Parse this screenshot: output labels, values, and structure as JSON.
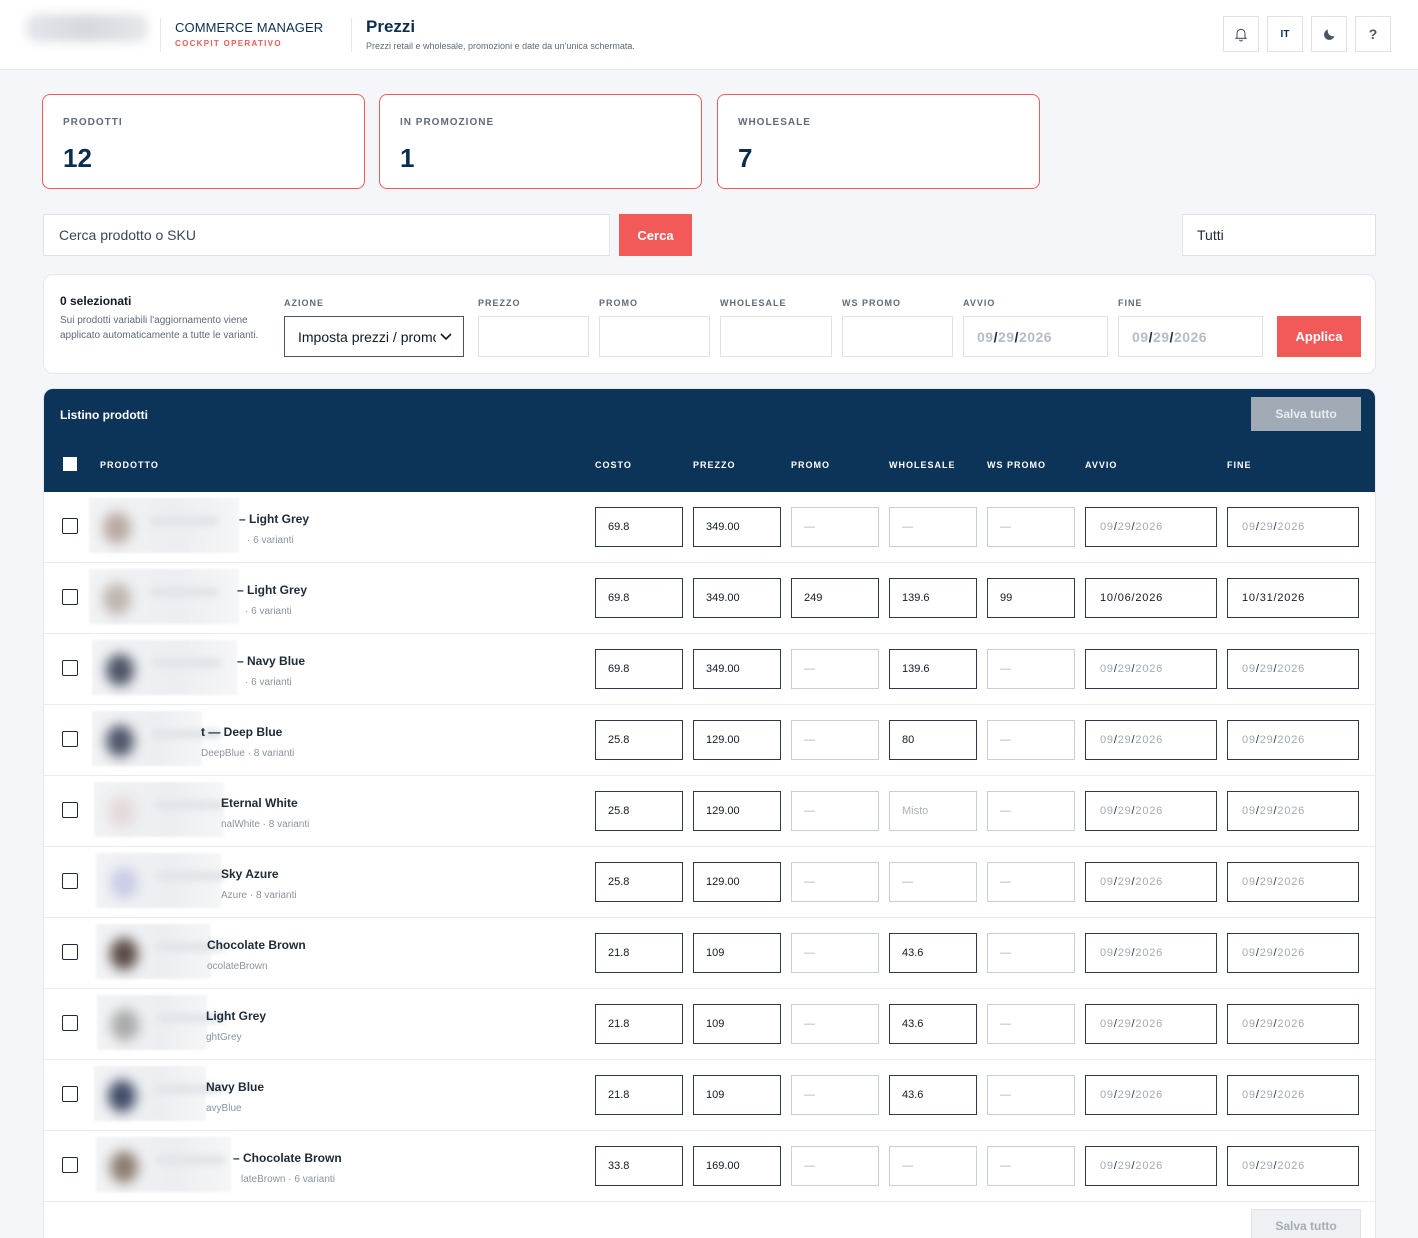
{
  "header": {
    "brand_title": "COMMERCE MANAGER",
    "brand_subtitle": "COCKPIT OPERATIVO",
    "page_title": "Prezzi",
    "page_subtitle": "Prezzi retail e wholesale, promozioni e date da un'unica schermata.",
    "lang": "IT",
    "help": "?"
  },
  "stats": [
    {
      "label": "PRODOTTI",
      "value": "12"
    },
    {
      "label": "IN PROMOZIONE",
      "value": "1"
    },
    {
      "label": "WHOLESALE",
      "value": "7"
    }
  ],
  "search": {
    "placeholder": "Cerca prodotto o SKU",
    "button": "Cerca",
    "filter": "Tutti"
  },
  "bulk": {
    "selected": "0 selezionati",
    "note": "Sui prodotti variabili l'aggiornamento viene applicato automaticamente a tutte le varianti.",
    "labels": {
      "azione": "AZIONE",
      "prezzo": "PREZZO",
      "promo": "PROMO",
      "wholesale": "WHOLESALE",
      "ws_promo": "WS PROMO",
      "avvio": "AVVIO",
      "fine": "FINE"
    },
    "action_value": "Imposta prezzi / promo",
    "date_placeholder": {
      "mm": "09",
      "dd": "29",
      "yyyy": "2026"
    },
    "apply": "Applica"
  },
  "table": {
    "title": "Listino prodotti",
    "save": "Salva tutto",
    "columns": {
      "prodotto": "PRODOTTO",
      "costo": "COSTO",
      "prezzo": "PREZZO",
      "promo": "PROMO",
      "wholesale": "WHOLESALE",
      "ws_promo": "WS PROMO",
      "avvio": "AVVIO",
      "fine": "FINE"
    },
    "empty": "—",
    "rows": [
      {
        "name": "– Light Grey",
        "meta": "· 6 varianti",
        "costo": "69.8",
        "prezzo": "349.00",
        "promo": "",
        "wholesale": "",
        "ws_promo": "",
        "avvio": "",
        "fine": ""
      },
      {
        "name": "– Light Grey",
        "meta": "· 6 varianti",
        "costo": "69.8",
        "prezzo": "349.00",
        "promo": "249",
        "wholesale": "139.6",
        "ws_promo": "99",
        "avvio": "10/06/2026",
        "fine": "10/31/2026"
      },
      {
        "name": "– Navy Blue",
        "meta": "· 6 varianti",
        "costo": "69.8",
        "prezzo": "349.00",
        "promo": "",
        "wholesale": "139.6",
        "ws_promo": "",
        "avvio": "",
        "fine": ""
      },
      {
        "name": "t — Deep Blue",
        "meta": "DeepBlue · 8 varianti",
        "costo": "25.8",
        "prezzo": "129.00",
        "promo": "",
        "wholesale": "80",
        "ws_promo": "",
        "avvio": "",
        "fine": ""
      },
      {
        "name": "Eternal White",
        "meta": "nalWhite · 8 varianti",
        "costo": "25.8",
        "prezzo": "129.00",
        "promo": "",
        "wholesale": "Misto",
        "ws_promo": "",
        "avvio": "",
        "fine": ""
      },
      {
        "name": "Sky Azure",
        "meta": "Azure · 8 varianti",
        "costo": "25.8",
        "prezzo": "129.00",
        "promo": "",
        "wholesale": "",
        "ws_promo": "",
        "avvio": "",
        "fine": ""
      },
      {
        "name": "Chocolate Brown",
        "meta": "ocolateBrown",
        "costo": "21.8",
        "prezzo": "109",
        "promo": "",
        "wholesale": "43.6",
        "ws_promo": "",
        "avvio": "",
        "fine": ""
      },
      {
        "name": "Light Grey",
        "meta": "ghtGrey",
        "costo": "21.8",
        "prezzo": "109",
        "promo": "",
        "wholesale": "43.6",
        "ws_promo": "",
        "avvio": "",
        "fine": ""
      },
      {
        "name": "Navy Blue",
        "meta": "avyBlue",
        "costo": "21.8",
        "prezzo": "109",
        "promo": "",
        "wholesale": "43.6",
        "ws_promo": "",
        "avvio": "",
        "fine": ""
      },
      {
        "name": "– Chocolate Brown",
        "meta": "lateBrown · 6 varianti",
        "costo": "33.8",
        "prezzo": "169.00",
        "promo": "",
        "wholesale": "",
        "ws_promo": "",
        "avvio": "",
        "fine": ""
      }
    ]
  },
  "colors": {
    "accent": "#f25a5a",
    "navy": "#0c3358",
    "save_disabled": "#a0abb6"
  },
  "icons": {
    "notifications": "bell-icon",
    "theme": "moon-icon",
    "select": "chevron-down-icon"
  }
}
